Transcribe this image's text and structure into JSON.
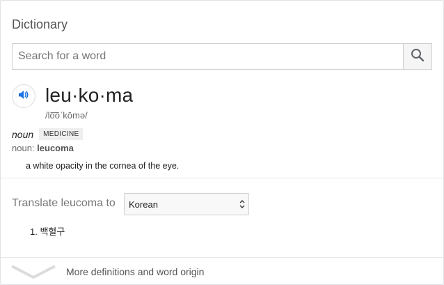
{
  "header": {
    "title": "Dictionary"
  },
  "search": {
    "placeholder": "Search for a word",
    "icon": "search-icon"
  },
  "entry": {
    "word": "leu·ko·ma",
    "pronunciation": "/lo͞oˈkōmə/",
    "part_of_speech": "noun",
    "domain_label": "MEDICINE",
    "variant_prefix": "noun:",
    "variant_word": "leucoma",
    "definition": "a white opacity in the cornea of the eye."
  },
  "translate": {
    "label": "Translate leucoma to",
    "selected_language": "Korean",
    "results": [
      "1. 백혈구"
    ]
  },
  "footer": {
    "more_label": "More definitions and word origin"
  },
  "colors": {
    "accent_blue": "#1a73e8",
    "icon_gray": "#5f6368"
  }
}
